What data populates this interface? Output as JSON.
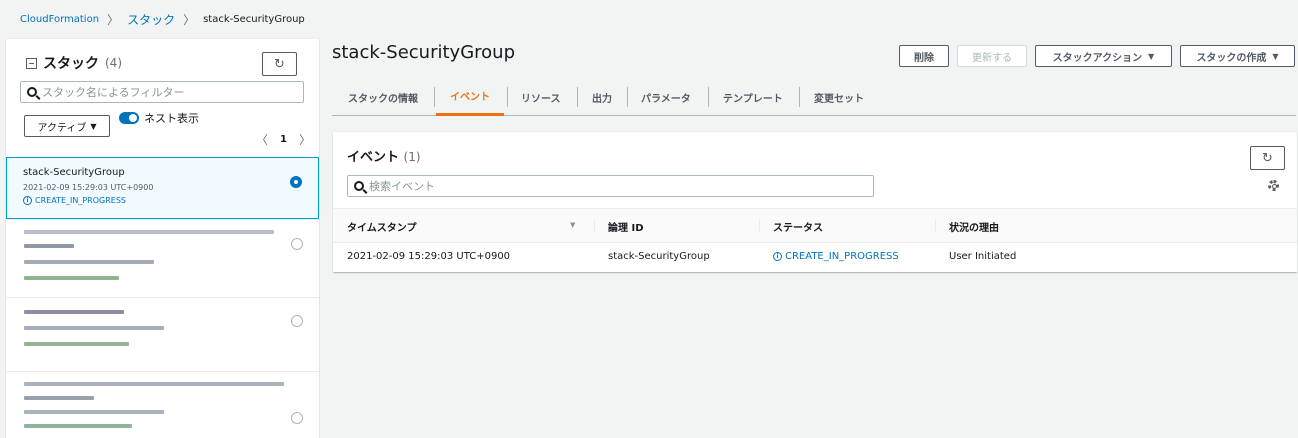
{
  "breadcrumb": {
    "root": "CloudFormation",
    "middle": "スタック",
    "current": "stack-SecurityGroup"
  },
  "stacks_panel": {
    "title": "スタック",
    "count": "(4)",
    "search_placeholder": "スタック名によるフィルター",
    "filter_value": "アクティブ",
    "toggle_label": "ネスト表示",
    "toggle_on": true,
    "page": "1",
    "items": [
      {
        "name": "stack-SecurityGroup",
        "date": "2021-02-09 15:29:03 UTC+0900",
        "status": "CREATE_IN_PROGRESS",
        "selected": true
      }
    ]
  },
  "main": {
    "title": "stack-SecurityGroup",
    "buttons": {
      "delete": "削除",
      "update": "更新する",
      "actions": "スタックアクション",
      "create": "スタックの作成"
    },
    "tabs": [
      {
        "label": "スタックの情報",
        "active": false
      },
      {
        "label": "イベント",
        "active": true
      },
      {
        "label": "リソース",
        "active": false
      },
      {
        "label": "出力",
        "active": false
      },
      {
        "label": "パラメータ",
        "active": false
      },
      {
        "label": "テンプレート",
        "active": false
      },
      {
        "label": "変更セット",
        "active": false
      }
    ]
  },
  "events": {
    "title": "イベント",
    "count": "(1)",
    "search_placeholder": "検索イベント",
    "columns": [
      "タイムスタンプ",
      "論理 ID",
      "ステータス",
      "状況の理由"
    ],
    "rows": [
      {
        "timestamp": "2021-02-09 15:29:03 UTC+0900",
        "logical_id": "stack-SecurityGroup",
        "status": "CREATE_IN_PROGRESS",
        "reason": "User Initiated"
      }
    ]
  },
  "colors": {
    "accent": "#ec7211",
    "link": "#0073bb",
    "selected_bg": "#f1faff",
    "selected_border": "#00a1c9"
  }
}
